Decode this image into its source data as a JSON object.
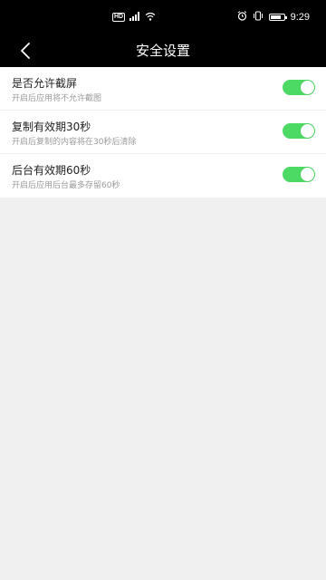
{
  "status_bar": {
    "time": "9:29",
    "left_icons": [
      "hd-icon",
      "signal-icon",
      "wifi-icon"
    ],
    "right_icons": [
      "alarm-icon",
      "vibrate-icon",
      "battery-icon"
    ],
    "battery_level": 0.8
  },
  "header": {
    "title": "安全设置",
    "back_icon": "chevron-left-icon"
  },
  "settings": [
    {
      "title": "是否允许截屏",
      "description": "开启后应用将不允许截图",
      "enabled": true
    },
    {
      "title": "复制有效期30秒",
      "description": "开启后复制的内容将在30秒后清除",
      "enabled": true
    },
    {
      "title": "后台有效期60秒",
      "description": "开启后应用后台最多存留60秒",
      "enabled": true
    }
  ],
  "colors": {
    "header_bg": "#000000",
    "toggle_on": "#4cd964",
    "page_bg": "#f0f0f0"
  }
}
